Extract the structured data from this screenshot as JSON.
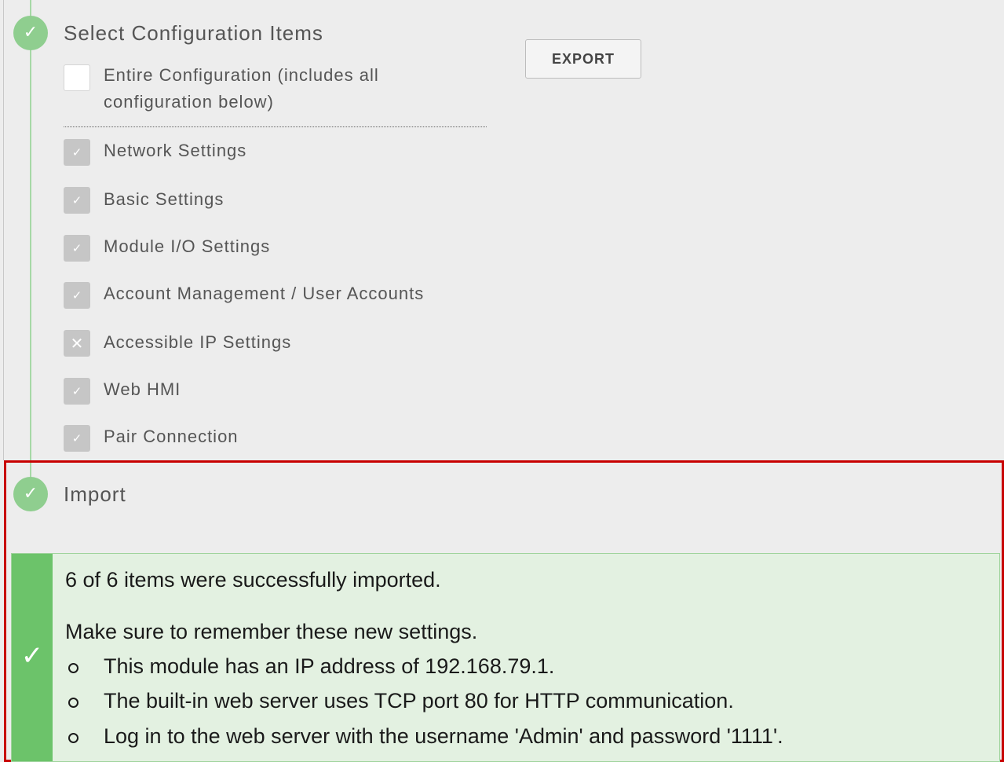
{
  "select_section": {
    "title": "Select Configuration Items",
    "step_icon": "check-icon"
  },
  "export_button": {
    "label": "EXPORT"
  },
  "entire_configuration": {
    "label": "Entire Configuration (includes all configuration below)",
    "checked": false
  },
  "items": [
    {
      "label": "Network Settings",
      "state": "checked-disabled",
      "icon": "checkmark-icon"
    },
    {
      "label": "Basic Settings",
      "state": "checked-disabled",
      "icon": "checkmark-icon"
    },
    {
      "label": "Module I/O Settings",
      "state": "checked-disabled",
      "icon": "checkmark-icon"
    },
    {
      "label": "Account Management / User Accounts",
      "state": "checked-disabled",
      "icon": "checkmark-icon"
    },
    {
      "label": "Accessible IP Settings",
      "state": "excluded-disabled",
      "icon": "x-icon"
    },
    {
      "label": "Web HMI",
      "state": "checked-disabled",
      "icon": "checkmark-icon"
    },
    {
      "label": "Pair Connection",
      "state": "checked-disabled",
      "icon": "checkmark-icon"
    }
  ],
  "import_section": {
    "title": "Import",
    "step_icon": "check-icon"
  },
  "alert": {
    "summary": "6 of 6 items were successfully imported.",
    "intro": "Make sure to remember these new settings.",
    "bullets": [
      "This module has an IP address of 192.168.79.1.",
      "The built-in web server uses TCP port 80 for HTTP communication.",
      "Log in to the web server with the username 'Admin' and password '1111'."
    ],
    "icon": "success-check-icon"
  },
  "colors": {
    "step_circle": "#8fce8f",
    "timeline": "#a6d8a6",
    "highlight_border": "#c80000",
    "alert_background": "#e3f1e1",
    "alert_bar": "#6cc36a"
  }
}
